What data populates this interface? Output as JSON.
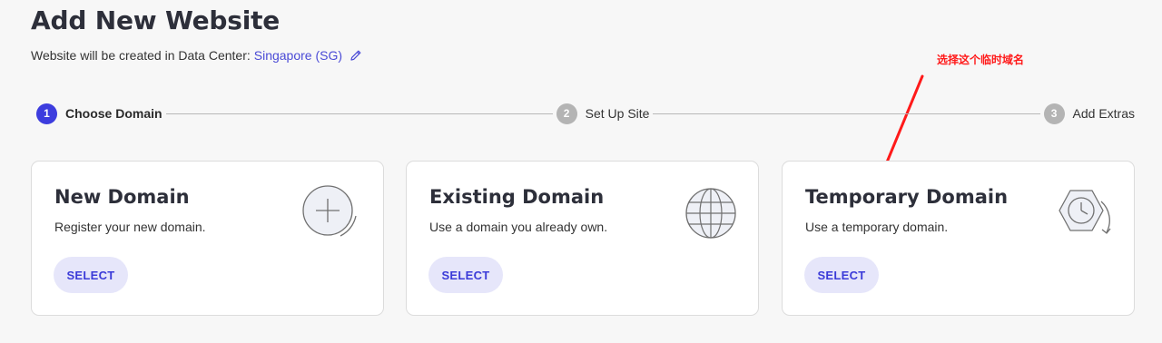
{
  "header": {
    "title": "Add New Website",
    "data_center_prefix": "Website will be created in Data Center:",
    "data_center_link": "Singapore (SG)"
  },
  "annotation": {
    "text": "选择这个临时域名",
    "color": "#ff1a1a"
  },
  "stepper": {
    "steps": [
      {
        "number": "1",
        "label": "Choose Domain",
        "active": true
      },
      {
        "number": "2",
        "label": "Set Up Site",
        "active": false
      },
      {
        "number": "3",
        "label": "Add Extras",
        "active": false
      }
    ]
  },
  "cards": [
    {
      "title": "New Domain",
      "description": "Register your new domain.",
      "button": "SELECT",
      "icon": "plus-circle-icon"
    },
    {
      "title": "Existing Domain",
      "description": "Use a domain you already own.",
      "button": "SELECT",
      "icon": "globe-icon"
    },
    {
      "title": "Temporary Domain",
      "description": "Use a temporary domain.",
      "button": "SELECT",
      "icon": "clock-hexagon-icon"
    }
  ],
  "colors": {
    "accent": "#3d3dde",
    "link": "#4a4ad6",
    "button_bg": "#e6e6fa",
    "background": "#f7f7f7"
  }
}
